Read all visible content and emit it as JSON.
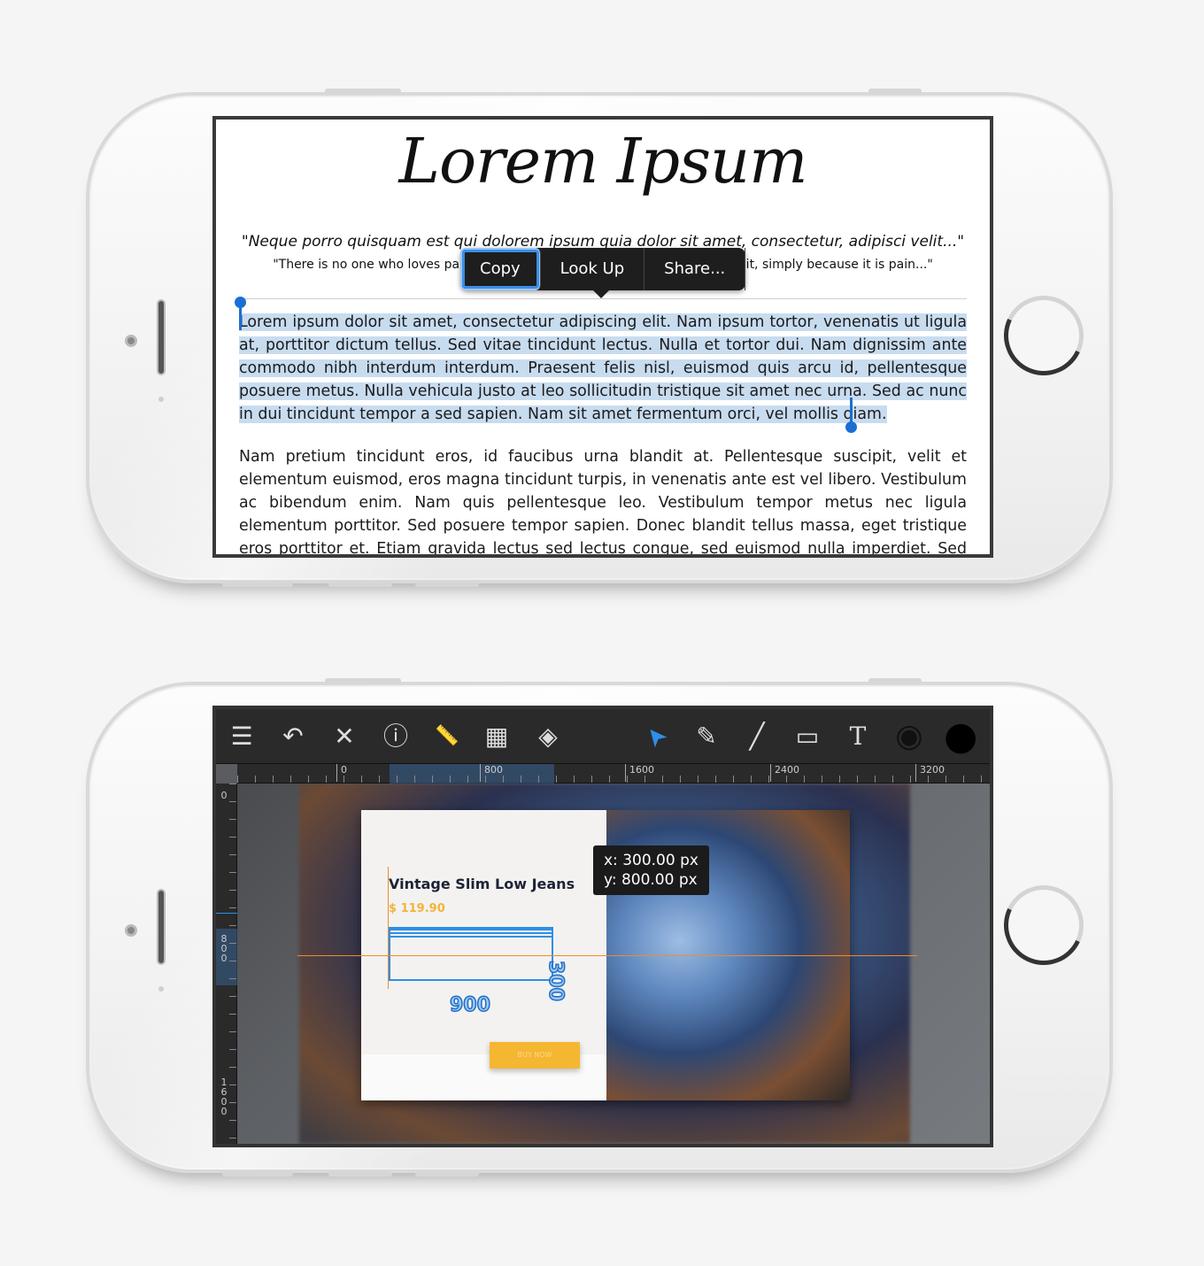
{
  "reader": {
    "title": "Lorem Ipsum",
    "quote_latin": "\"Neque porro quisquam est qui dolorem ipsum quia dolor sit amet, consectetur, adipisci velit...\"",
    "quote_english": "\"There is no one who loves pain itself, who seeks after it and wants to have it, simply because it is pain...\"",
    "paragraph_selected": "Lorem ipsum dolor sit amet, consectetur adipiscing elit. Nam ipsum tortor, venenatis ut ligula at, porttitor dictum tellus. Sed vitae tincidunt lectus. Nulla et tortor dui. Nam dignissim ante commodo nibh interdum interdum. Praesent felis nisl, euismod quis arcu id, pellentesque posuere metus. Nulla vehicula justo at leo sollicitudin tristique sit amet nec urna. Sed ac nunc in dui tincidunt tempor a sed sapien. Nam sit amet fermentum orci, vel mollis diam.",
    "paragraph_2": "Nam pretium tincidunt eros, id faucibus urna blandit at. Pellentesque suscipit, velit et elementum euismod, eros magna tincidunt turpis, in venenatis ante est vel libero. Vestibulum ac bibendum enim. Nam quis pellentesque leo. Vestibulum tempor metus nec ligula elementum porttitor. Sed posuere tempor sapien. Donec blandit tellus massa, eget tristique eros porttitor et. Etiam gravida lectus sed lectus congue, sed euismod nulla imperdiet. Sed eget est nec nisi",
    "context_menu": [
      {
        "label": "Copy"
      },
      {
        "label": "Look Up"
      },
      {
        "label": "Share..."
      }
    ],
    "selection_color": "#c8dcf0",
    "handle_color": "#1a6fd4"
  },
  "editor": {
    "toolbar": [
      {
        "icon": "menu-icon",
        "glyph": "☰"
      },
      {
        "icon": "undo-icon",
        "glyph": "↶"
      },
      {
        "icon": "close-icon",
        "glyph": "✕"
      },
      {
        "icon": "info-icon",
        "glyph": "ⓘ"
      },
      {
        "icon": "ruler-icon",
        "glyph": "📏"
      },
      {
        "icon": "assets-icon",
        "glyph": "▦"
      },
      {
        "icon": "layers-icon",
        "glyph": "◈"
      },
      {
        "icon": "pointer-tool-icon",
        "glyph": "➤"
      },
      {
        "icon": "pencil-tool-icon",
        "glyph": "✎"
      },
      {
        "icon": "line-tool-icon",
        "glyph": "╱"
      },
      {
        "icon": "rectangle-tool-icon",
        "glyph": "▭"
      },
      {
        "icon": "text-tool-icon",
        "glyph": "T"
      },
      {
        "icon": "stroke-color-icon",
        "glyph": "◉"
      },
      {
        "icon": "fill-color-icon",
        "glyph": "●"
      }
    ],
    "h_ruler_labels": [
      "0",
      "800",
      "1600",
      "2400",
      "3200"
    ],
    "v_ruler_labels": [
      "0",
      "800",
      "1600"
    ],
    "coordinates": "x: 300.00 px\ny: 800.00 px",
    "product_title": "Vintage Slim Low Jeans",
    "price": "$ 119.90",
    "buy_button": "BUY NOW",
    "width_dimension": "900",
    "height_dimension": "300",
    "accent_color": "#2d8fe8",
    "guide_color": "#f28a2a",
    "price_color": "#f2b43a"
  }
}
